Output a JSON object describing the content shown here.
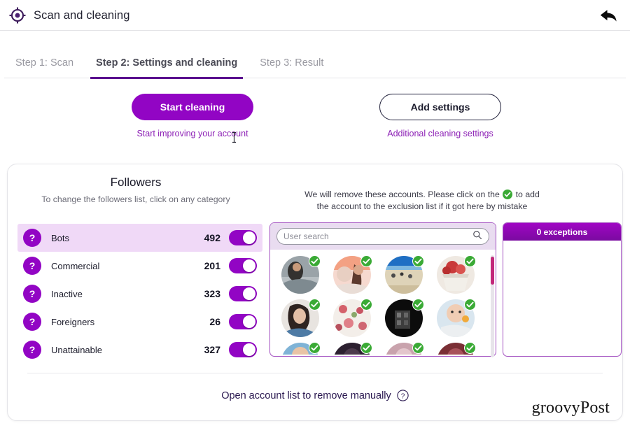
{
  "window": {
    "title": "Scan and cleaning",
    "app_icon": "target-icon",
    "back_icon": "back-arrow-icon"
  },
  "tabs": [
    {
      "label": "Step 1: Scan",
      "active": false
    },
    {
      "label": "Step 2: Settings and cleaning",
      "active": true
    },
    {
      "label": "Step 3: Result",
      "active": false
    }
  ],
  "actions": {
    "primary": {
      "label": "Start cleaning",
      "sub": "Start improving your account"
    },
    "secondary": {
      "label": "Add settings",
      "sub": "Additional cleaning settings"
    }
  },
  "followers": {
    "title": "Followers",
    "subtitle": "To change the followers list, click on any category",
    "categories": [
      {
        "label": "Bots",
        "count": "492",
        "enabled": true,
        "selected": true
      },
      {
        "label": "Commercial",
        "count": "201",
        "enabled": true,
        "selected": false
      },
      {
        "label": "Inactive",
        "count": "323",
        "enabled": true,
        "selected": false
      },
      {
        "label": "Foreigners",
        "count": "26",
        "enabled": true,
        "selected": false
      },
      {
        "label": "Unattainable",
        "count": "327",
        "enabled": true,
        "selected": false
      }
    ]
  },
  "removal_note": {
    "line1_before": "We will remove these accounts. Please click on the",
    "line1_after": "to add",
    "line2": "the account to the exclusion list if it got here by mistake"
  },
  "search": {
    "placeholder": "User search",
    "value": "",
    "icon": "search-icon"
  },
  "exceptions": {
    "header": "0 exceptions"
  },
  "footer": {
    "link": "Open account list to remove manually",
    "help_icon": "question-circle-icon",
    "watermark": "groovyPost"
  },
  "colors": {
    "accent_purple": "#9205c4",
    "tab_underline": "#5b0f8f",
    "selected_row": "#f0d9f7",
    "check_green": "#3aaa35",
    "scrollbar_thumb": "#c2297a",
    "panel_border": "#a24fc0"
  }
}
